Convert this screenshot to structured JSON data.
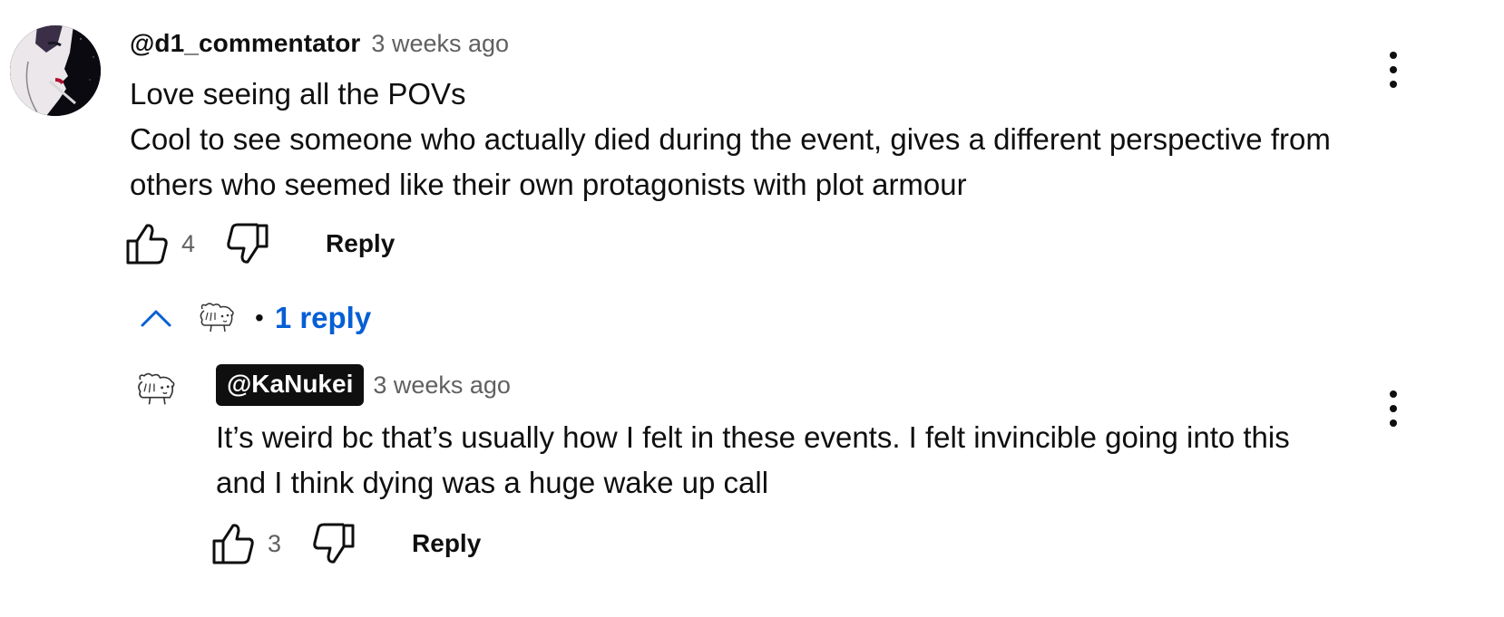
{
  "comment": {
    "author": "@d1_commentator",
    "timestamp": "3 weeks ago",
    "lines": [
      "Love seeing all the POVs",
      "Cool to see someone who actually died during the event, gives a different perspective from",
      "others who seemed like their own protagonists with plot armour"
    ],
    "like_count": "4",
    "reply_label": "Reply",
    "avatar_icon": "avatar-dark-portrait-icon",
    "menu_icon": "more-vertical-icon"
  },
  "replies_toggle": {
    "label": "1 reply",
    "separator": "•",
    "chevron_icon": "chevron-up-icon",
    "thread_avatar_icon": "sketch-character-icon"
  },
  "reply": {
    "author": "@KaNukei",
    "timestamp": "3 weeks ago",
    "lines": [
      "It’s weird bc that’s usually how I felt in these events. I felt invincible going into this",
      "and I think dying was a huge wake up call"
    ],
    "like_count": "3",
    "reply_label": "Reply",
    "avatar_icon": "sketch-character-icon",
    "menu_icon": "more-vertical-icon"
  },
  "colors": {
    "link_blue": "#065fd4",
    "text": "#0f0f0f",
    "secondary_text": "#606060",
    "chip_background": "#0f0f0f"
  }
}
